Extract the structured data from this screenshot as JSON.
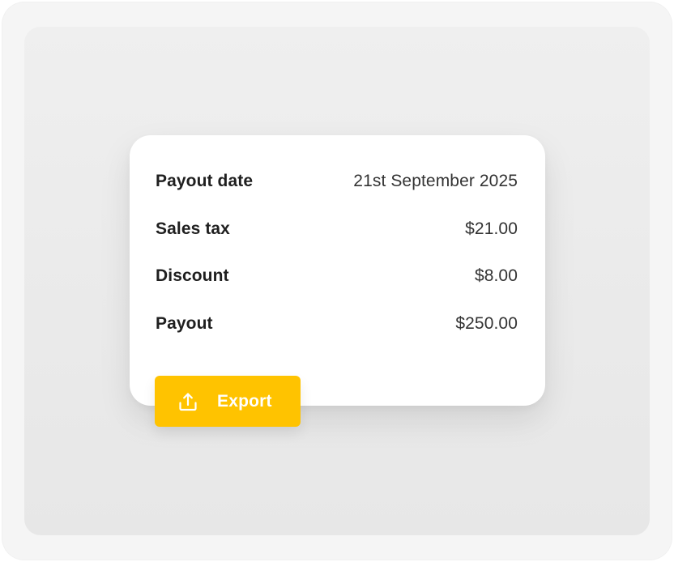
{
  "card": {
    "rows": [
      {
        "label": "Payout date",
        "value": "21st September 2025"
      },
      {
        "label": "Sales tax",
        "value": "$21.00"
      },
      {
        "label": "Discount",
        "value": "$8.00"
      },
      {
        "label": "Payout",
        "value": "$250.00"
      }
    ]
  },
  "export": {
    "label": "Export",
    "icon": "upload-icon",
    "color": "#ffc300"
  },
  "colors": {
    "frame": "#f5f5f5",
    "panel": "#ebebeb",
    "card": "#ffffff",
    "text_label": "#1f1f1f",
    "text_value": "#333333"
  }
}
